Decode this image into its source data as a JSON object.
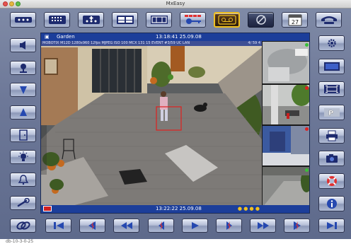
{
  "window": {
    "title": "MxEasy"
  },
  "camera": {
    "name": "Garden",
    "time_top": "13:18:41 25.09.08",
    "time_bottom": "13:22:22 25.09.08",
    "osd_text": "MOBOTIX M12D  1280x960  12fps  MJPEG  ISO 100  MCX  131  15  EVENT  #3/59  UC  LAN",
    "osd_right": "4/ 59 4"
  },
  "calendar_badge": "27",
  "status_bar": "db-10-3-0-25",
  "colors": {
    "chrome": "#6d7898",
    "video_header": "#1c3e9a",
    "selected_border": "#f0c020",
    "record_red": "#e02020",
    "status_green": "#38c038"
  },
  "top_toolbar": [
    {
      "name": "layout-dots-1-icon",
      "label": ""
    },
    {
      "name": "layout-grid-icon",
      "label": ""
    },
    {
      "name": "layout-add-icon",
      "label": ""
    },
    {
      "name": "layout-quad-icon",
      "label": ""
    },
    {
      "name": "layout-window-icon",
      "label": ""
    },
    {
      "name": "key-icon",
      "label": ""
    },
    {
      "name": "cassette-icon",
      "label": ""
    },
    {
      "name": "slash-icon",
      "label": ""
    },
    {
      "name": "calendar-icon",
      "label": "27"
    },
    {
      "name": "phone-icon",
      "label": ""
    }
  ],
  "left_toolbar": [
    "speaker-icon",
    "microphone-icon",
    "volume-down-icon",
    "volume-up-icon",
    "door-icon",
    "light-icon",
    "bell-icon",
    "wrench-icon"
  ],
  "right_toolbar": [
    "gear-icon",
    "screen-icon",
    "fullscreen-icon",
    "parking-icon",
    "printer-icon",
    "camera-icon",
    "lifebuoy-icon",
    "info-icon"
  ],
  "bottom_toolbar": [
    "link-icon",
    "skip-start-icon",
    "prev-event-icon",
    "rewind-icon",
    "step-back-icon",
    "play-icon",
    "step-forward-icon",
    "fast-forward-icon",
    "next-event-icon",
    "skip-end-icon"
  ]
}
